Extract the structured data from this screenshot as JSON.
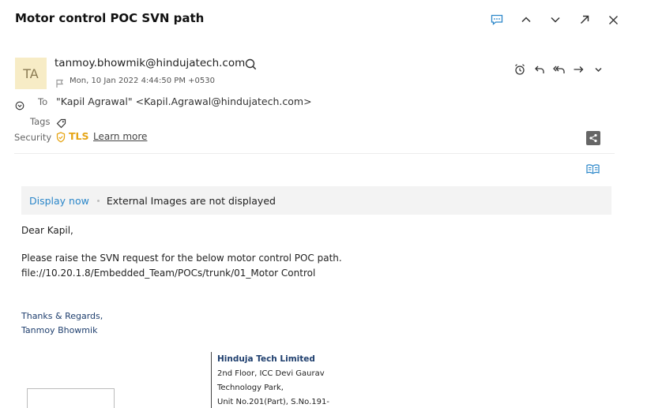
{
  "header": {
    "subject": "Motor control POC SVN path"
  },
  "top_actions": [
    "chat-icon",
    "chevron-up-icon",
    "chevron-down-icon",
    "popout-icon",
    "close-icon"
  ],
  "message": {
    "avatar_initials": "TA",
    "from": "tanmoy.bhowmik@hindujatech.com",
    "date": "Mon, 10 Jan 2022 4:44:50 PM +0530",
    "to_label": "To",
    "to_value": "\"Kapil Agrawal\" <Kapil.Agrawal@hindujatech.com>",
    "tags_label": "Tags",
    "security_label": "Security",
    "tls": "TLS",
    "learn_more": "Learn more"
  },
  "message_actions": [
    "reminder-icon",
    "reply-icon",
    "reply-all-icon",
    "forward-icon",
    "more-dropdown-icon"
  ],
  "images_bar": {
    "display_now": "Display now",
    "text": "External Images are not displayed"
  },
  "body": {
    "greeting": "Dear Kapil,",
    "line1": "Please raise the SVN request for the below motor control POC path.",
    "line2": "file://10.20.1.8/Embedded_Team/POCs/trunk/01_Motor Control"
  },
  "signature": {
    "regards": "Thanks  & Regards,",
    "name": "Tanmoy Bhowmik",
    "company": "Hinduja Tech Limited",
    "address1": "2nd Floor, ICC Devi Gaurav",
    "address2": "Technology Park,",
    "address3": "Unit No.201(Part), S.No.191-"
  },
  "colors": {
    "accent_blue": "#2a86c9",
    "tls_orange": "#e6a516",
    "signature_navy": "#1f3f6e",
    "avatar_bg": "#f7ecc6"
  }
}
